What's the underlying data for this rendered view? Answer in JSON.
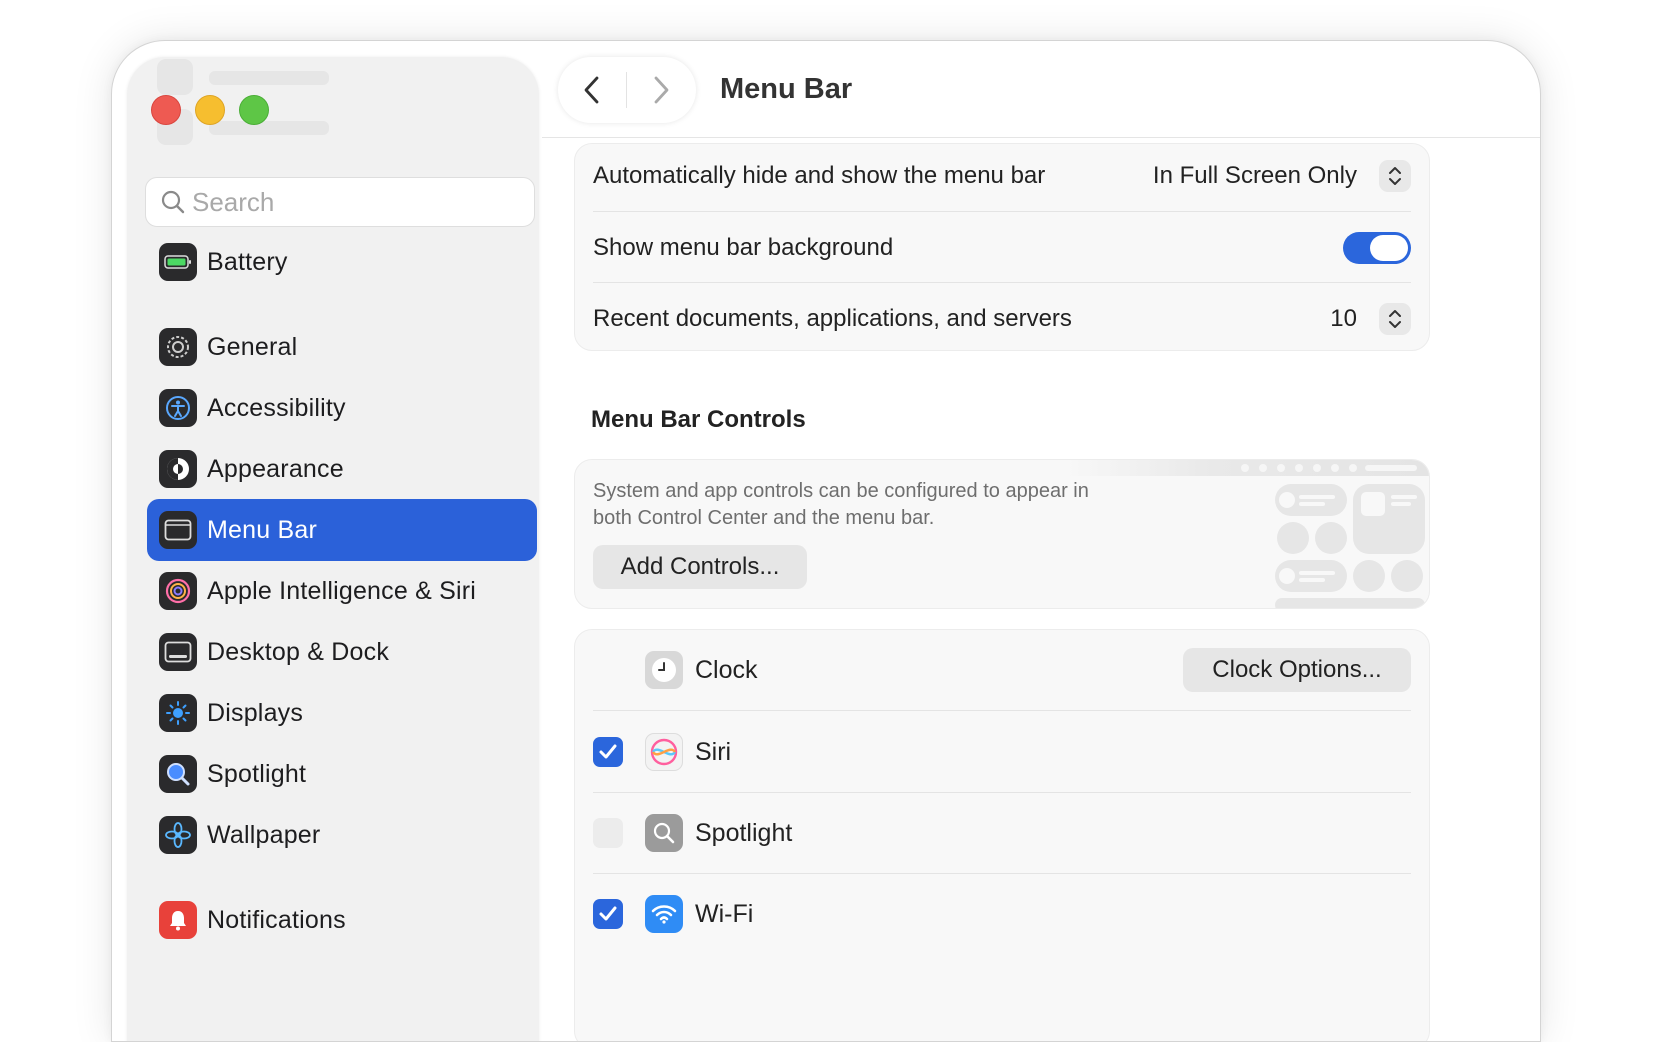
{
  "sidebar": {
    "search_placeholder": "Search",
    "items": [
      {
        "label": "Battery",
        "icon": "battery-icon"
      },
      {
        "label": "General",
        "icon": "gear-icon"
      },
      {
        "label": "Accessibility",
        "icon": "accessibility-icon"
      },
      {
        "label": "Appearance",
        "icon": "appearance-icon"
      },
      {
        "label": "Menu Bar",
        "icon": "menu-bar-icon",
        "active": true
      },
      {
        "label": "Apple Intelligence & Siri",
        "icon": "siri-icon"
      },
      {
        "label": "Desktop & Dock",
        "icon": "desktop-dock-icon"
      },
      {
        "label": "Displays",
        "icon": "displays-icon"
      },
      {
        "label": "Spotlight",
        "icon": "spotlight-icon"
      },
      {
        "label": "Wallpaper",
        "icon": "wallpaper-icon"
      },
      {
        "label": "Notifications",
        "icon": "notifications-icon"
      }
    ]
  },
  "header": {
    "title": "Menu Bar"
  },
  "settings": {
    "auto_hide_label": "Automatically hide and show the menu bar",
    "auto_hide_value": "In Full Screen Only",
    "background_label": "Show menu bar background",
    "background_on": true,
    "recent_label": "Recent documents, applications, and servers",
    "recent_value": "10"
  },
  "controls": {
    "section_title": "Menu Bar Controls",
    "description": "System and app controls can be configured to appear in both Control Center and the menu bar.",
    "add_button": "Add Controls...",
    "items": [
      {
        "label": "Clock",
        "checked": null,
        "button": "Clock Options..."
      },
      {
        "label": "Siri",
        "checked": true
      },
      {
        "label": "Spotlight",
        "checked": false
      },
      {
        "label": "Wi-Fi",
        "checked": true
      }
    ]
  },
  "colors": {
    "accent": "#2b61d9",
    "toggle": "#2b66dc"
  }
}
